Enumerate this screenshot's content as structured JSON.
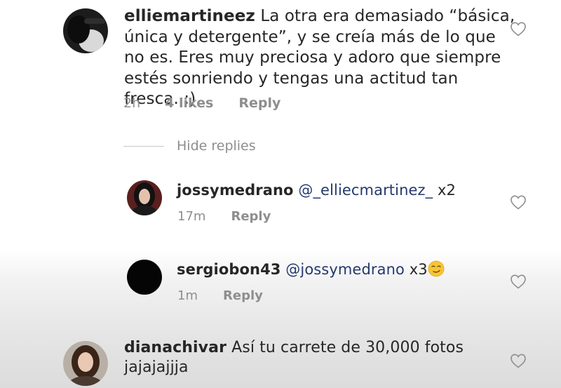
{
  "comments": [
    {
      "username": "elliemartineez",
      "text": "La otra era demasiado “básica, única y detergente”, y se creía más de lo que no es. Eres muy preciosa y adoro que siempre estés sonriendo y tengas una actitud tan fresca. :)",
      "time": "2h",
      "likes": "4 likes",
      "reply_label": "Reply",
      "icon": "heart-outline-icon",
      "hide_replies_label": "Hide replies",
      "replies": [
        {
          "username": "jossymedrano",
          "mention": "@_elliecmartinez_",
          "text": "x2",
          "time": "17m",
          "reply_label": "Reply",
          "icon": "heart-outline-icon"
        },
        {
          "username": "sergiobon43",
          "mention": "@jossymedrano",
          "text": "x3",
          "emoji": "smirking-face-emoji",
          "time": "1m",
          "reply_label": "Reply",
          "icon": "heart-outline-icon"
        }
      ]
    },
    {
      "username": "dianachivar",
      "text": "Así tu carrete de 30,000 fotos jajajajjja",
      "icon": "heart-outline-icon"
    }
  ],
  "colors": {
    "text": "#262626",
    "meta": "#8e8e8e",
    "mention": "#243a6e"
  }
}
